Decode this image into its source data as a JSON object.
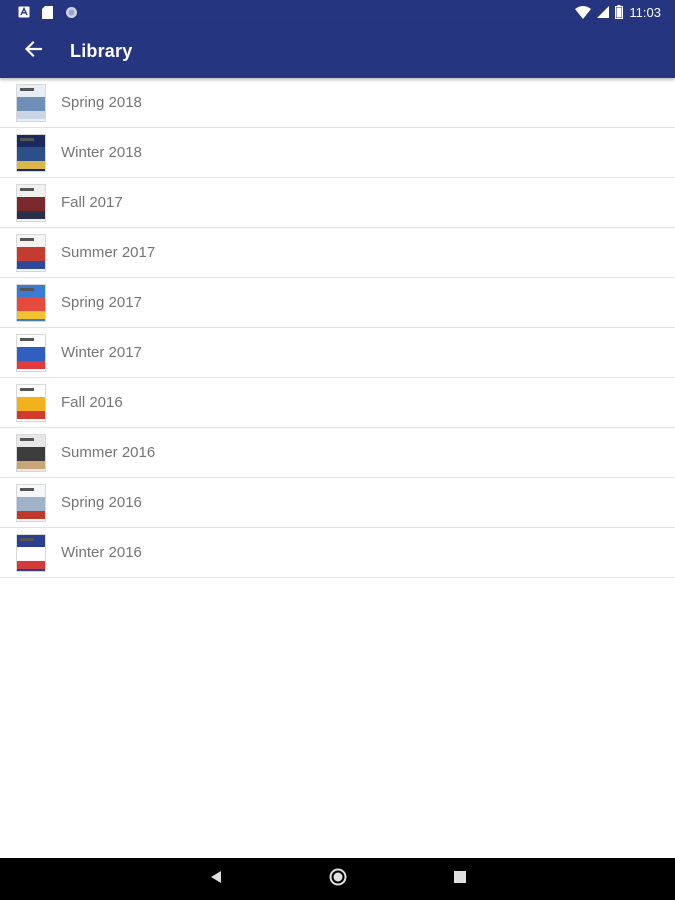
{
  "status_bar": {
    "time": "11:03",
    "left_icons": [
      "notification-a-icon",
      "sd-card-icon",
      "sync-circle-icon"
    ],
    "right_icons": [
      "wifi-icon",
      "cell-signal-icon",
      "battery-icon"
    ]
  },
  "app_bar": {
    "title": "Library",
    "back_icon": "arrow-back-icon",
    "color": "#263580"
  },
  "library": {
    "items": [
      {
        "label": "Spring 2018",
        "cover_colors": [
          "#e8eef5",
          "#6d8fb8",
          "#c9d6e6"
        ]
      },
      {
        "label": "Winter 2018",
        "cover_colors": [
          "#1b2a5c",
          "#2c4f8a",
          "#d9b84a"
        ]
      },
      {
        "label": "Fall 2017",
        "cover_colors": [
          "#f0f0f0",
          "#7a2a2a",
          "#2a2f4a"
        ]
      },
      {
        "label": "Summer 2017",
        "cover_colors": [
          "#f4f4f4",
          "#c43b2f",
          "#2d4a9a"
        ]
      },
      {
        "label": "Spring 2017",
        "cover_colors": [
          "#3a7bd5",
          "#e64a3c",
          "#f2c230"
        ]
      },
      {
        "label": "Winter 2017",
        "cover_colors": [
          "#ffffff",
          "#2f5fbf",
          "#e03a3a"
        ]
      },
      {
        "label": "Fall 2016",
        "cover_colors": [
          "#ffffff",
          "#f2b21b",
          "#d23a2a"
        ]
      },
      {
        "label": "Summer 2016",
        "cover_colors": [
          "#e8e8e8",
          "#3c3c3c",
          "#c9a57a"
        ]
      },
      {
        "label": "Spring 2016",
        "cover_colors": [
          "#f5f7fa",
          "#9fb3c8",
          "#c0392b"
        ]
      },
      {
        "label": "Winter 2016",
        "cover_colors": [
          "#2a3f8f",
          "#ffffff",
          "#d33b3b"
        ]
      }
    ]
  },
  "nav_bar": {
    "buttons": [
      "back-triangle-icon",
      "home-circle-icon",
      "recents-square-icon"
    ]
  }
}
